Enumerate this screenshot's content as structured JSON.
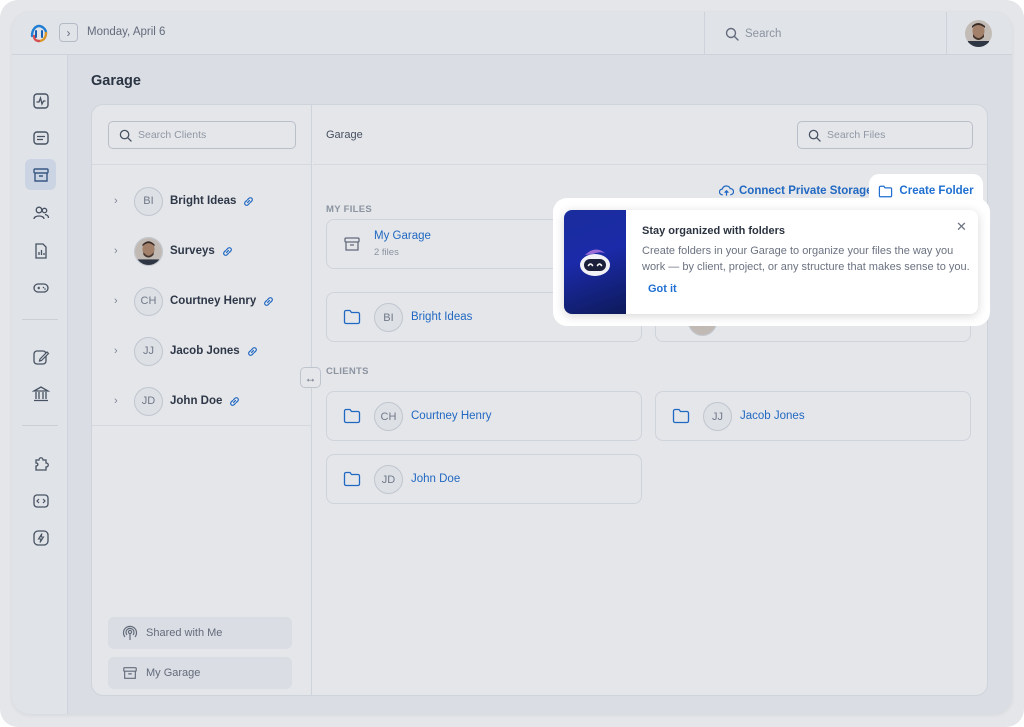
{
  "topbar": {
    "date": "Monday, April 6",
    "search_placeholder": "Search"
  },
  "page": {
    "title": "Garage"
  },
  "clients_pane": {
    "search_placeholder": "Search Clients",
    "clients": [
      {
        "initials": "BI",
        "name": "Bright Ideas",
        "photo": false
      },
      {
        "initials": "",
        "name": "Surveys",
        "photo": true
      },
      {
        "initials": "CH",
        "name": "Courtney Henry",
        "photo": false
      },
      {
        "initials": "JJ",
        "name": "Jacob Jones",
        "photo": false
      },
      {
        "initials": "JD",
        "name": "John Doe",
        "photo": false
      }
    ],
    "shared_with_me": "Shared with Me",
    "my_garage": "My Garage"
  },
  "files_pane": {
    "breadcrumb": "Garage",
    "search_placeholder": "Search Files",
    "my_files_label": "MY FILES",
    "connect_storage": "Connect Private Storage",
    "create_folder": "Create Folder",
    "my_garage_card": {
      "name": "My Garage",
      "count": "2 files"
    },
    "my_files_folders": [
      {
        "initials": "BI",
        "name": "Bright Ideas"
      }
    ],
    "clients_label": "CLIENTS",
    "client_folders": [
      {
        "initials": "CH",
        "name": "Courtney Henry"
      },
      {
        "initials": "JJ",
        "name": "Jacob Jones"
      },
      {
        "initials": "JD",
        "name": "John Doe"
      }
    ]
  },
  "tooltip": {
    "title": "Stay organized with folders",
    "body": "Create folders in your Garage to organize your files the way you work — by client, project, or any structure that makes sense to you.",
    "got_it": "Got it"
  },
  "colors": {
    "accent": "#1f6fd1",
    "tooltip_image": "#1b2aa8"
  }
}
